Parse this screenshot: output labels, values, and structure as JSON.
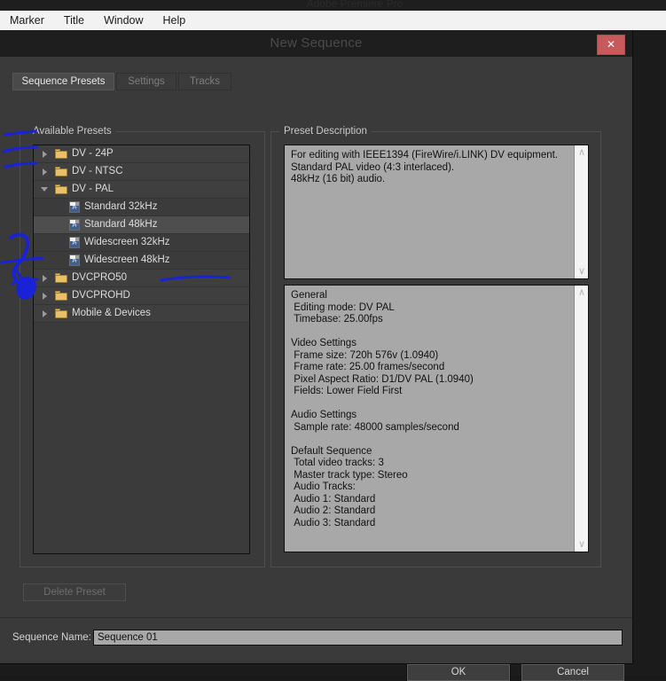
{
  "app": {
    "ghost_title": "Adobe Premiere Pro"
  },
  "menubar": {
    "items": [
      {
        "label": "Marker"
      },
      {
        "label": "Title"
      },
      {
        "label": "Window"
      },
      {
        "label": "Help"
      }
    ]
  },
  "dialog": {
    "title": "New Sequence",
    "close_label": "✕",
    "tabs": [
      {
        "label": "Sequence Presets",
        "active": true
      },
      {
        "label": "Settings",
        "active": false
      },
      {
        "label": "Tracks",
        "active": false
      }
    ],
    "presets_group_label": "Available Presets",
    "description_group_label": "Preset Description",
    "preset_tree": [
      {
        "label": "DV - 24P",
        "type": "folder",
        "expanded": false,
        "selected": false
      },
      {
        "label": "DV - NTSC",
        "type": "folder",
        "expanded": false,
        "selected": false
      },
      {
        "label": "DV - PAL",
        "type": "folder",
        "expanded": true,
        "selected": false
      },
      {
        "label": "Standard 32kHz",
        "type": "preset",
        "expanded": false,
        "selected": false
      },
      {
        "label": "Standard 48kHz",
        "type": "preset",
        "expanded": false,
        "selected": true
      },
      {
        "label": "Widescreen 32kHz",
        "type": "preset",
        "expanded": false,
        "selected": false
      },
      {
        "label": "Widescreen 48kHz",
        "type": "preset",
        "expanded": false,
        "selected": false
      },
      {
        "label": "DVCPRO50",
        "type": "folder",
        "expanded": false,
        "selected": false
      },
      {
        "label": "DVCPROHD",
        "type": "folder",
        "expanded": false,
        "selected": false
      },
      {
        "label": "Mobile & Devices",
        "type": "folder",
        "expanded": false,
        "selected": false
      }
    ],
    "preset_icon_text": "Pr",
    "description_text": "For editing with IEEE1394 (FireWire/i.LINK) DV equipment.\nStandard PAL video (4:3 interlaced).\n48kHz (16 bit) audio.",
    "settings_text": "General\n Editing mode: DV PAL\n Timebase: 25.00fps\n\nVideo Settings\n Frame size: 720h 576v (1.0940)\n Frame rate: 25.00 frames/second\n Pixel Aspect Ratio: D1/DV PAL (1.0940)\n Fields: Lower Field First\n\nAudio Settings\n Sample rate: 48000 samples/second\n\nDefault Sequence\n Total video tracks: 3\n Master track type: Stereo\n Audio Tracks:\n Audio 1: Standard\n Audio 2: Standard\n Audio 3: Standard",
    "scroll_up_glyph": "∧",
    "scroll_down_glyph": "∨",
    "delete_preset_label": "Delete Preset",
    "sequence_name_label": "Sequence Name:",
    "sequence_name_value": "Sequence 01",
    "ok_label": "OK",
    "cancel_label": "Cancel"
  },
  "annotation": {
    "ink_color": "#1a22d8"
  }
}
